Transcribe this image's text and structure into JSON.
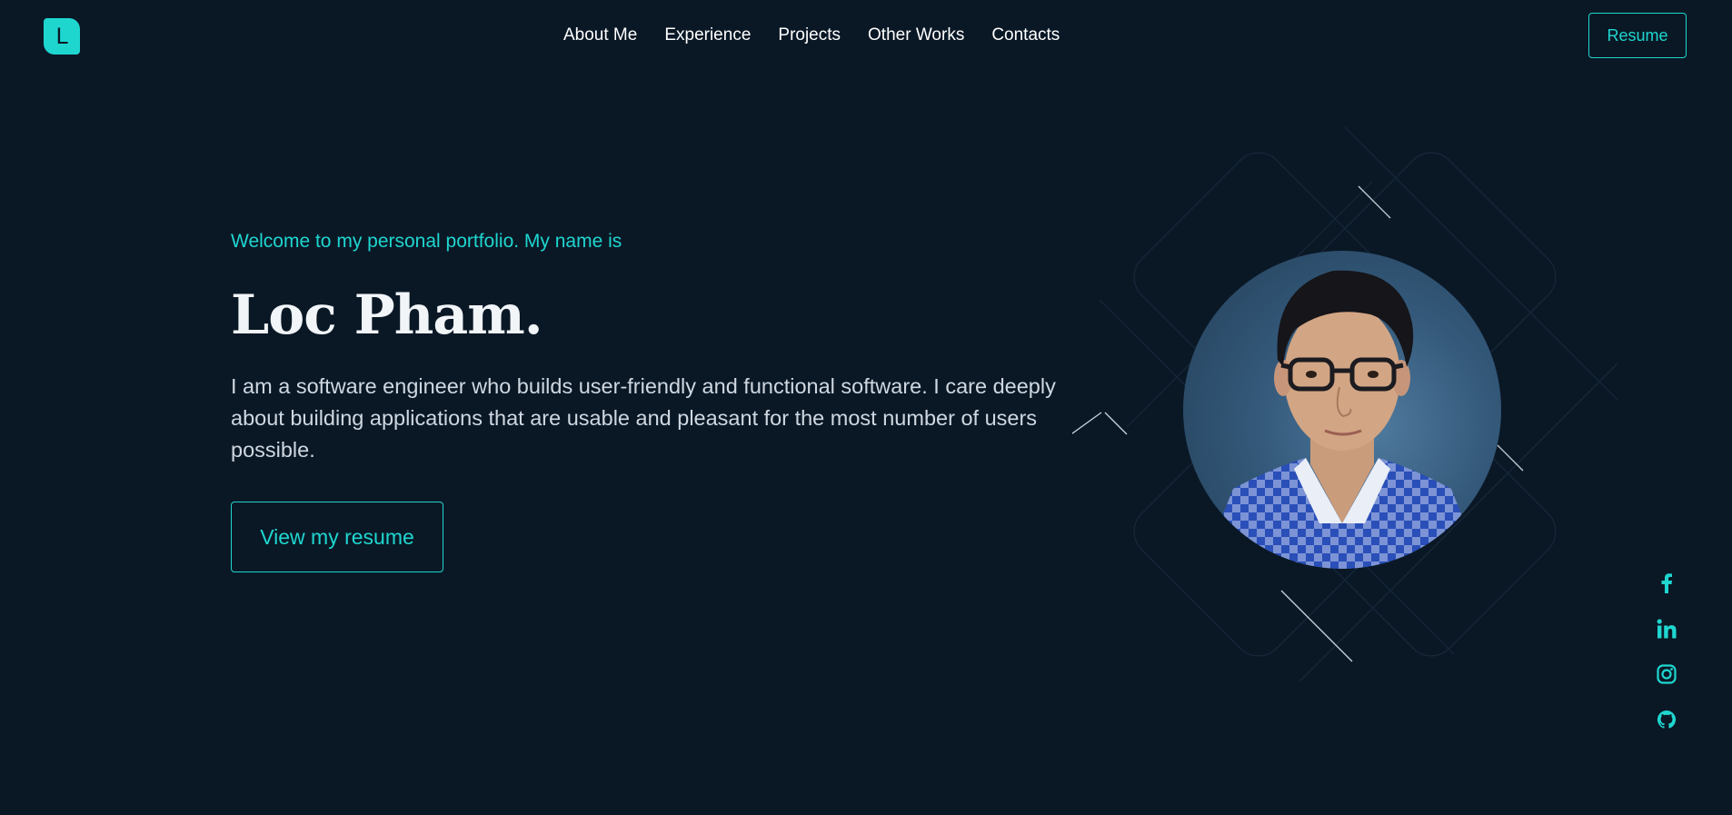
{
  "header": {
    "logo_letter": "L",
    "nav": [
      {
        "label": "About Me"
      },
      {
        "label": "Experience"
      },
      {
        "label": "Projects"
      },
      {
        "label": "Other Works"
      },
      {
        "label": "Contacts"
      }
    ],
    "resume_label": "Resume"
  },
  "hero": {
    "greeting": "Welcome to my personal portfolio. My name is",
    "name": "Loc Pham.",
    "bio": "I am a software engineer who builds user-friendly and functional software. I care deeply about building applications that are usable and pleasant for the most number of users possible.",
    "cta_label": "View my resume"
  },
  "social": {
    "icons": [
      "facebook-icon",
      "linkedin-icon",
      "instagram-icon",
      "github-icon"
    ]
  },
  "colors": {
    "background": "#0a1826",
    "accent": "#1fd6cf",
    "heading": "#f2f5f8",
    "body_text": "#cfd8e1"
  }
}
